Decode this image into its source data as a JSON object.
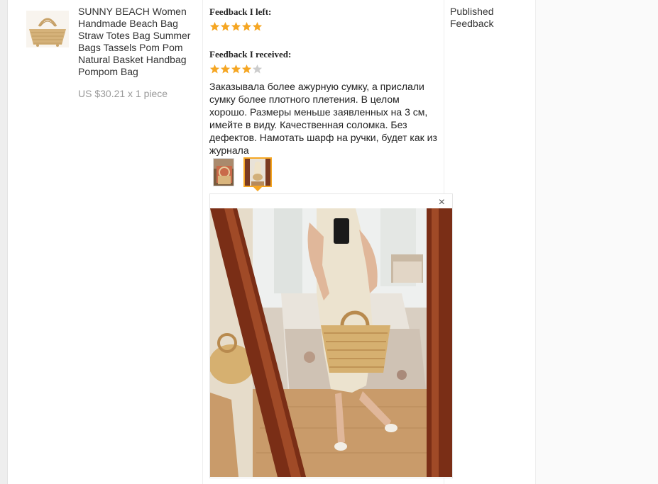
{
  "order_item": {
    "title": "SUNNY BEACH Women Handmade Beach Bag Straw Totes Bag Summer Bags Tassels Pom Pom Natural Basket Handbag Pompom Bag",
    "price": "US $30.21 x 1 piece"
  },
  "feedback_left": {
    "heading": "Feedback I left:",
    "rating": 5,
    "max_rating": 5
  },
  "feedback_received": {
    "heading": "Feedback I received:",
    "rating": 4,
    "max_rating": 5,
    "text": "Заказывала более ажурную сумку, а прислали сумку более плотного плетения. В целом хорошо. Размеры меньше заявленных на 3 см, имейте в виду. Качественная соломка. Без дефектов. Намотать шарф на ручки, будет как из журнала",
    "photo_count": 2,
    "selected_photo": 2
  },
  "status": {
    "label": "Published Feedback"
  },
  "viewer": {
    "close_glyph": "×"
  },
  "colors": {
    "star_filled": "#f5a623",
    "star_empty": "#cccccc",
    "selected_border": "#f5a623"
  }
}
